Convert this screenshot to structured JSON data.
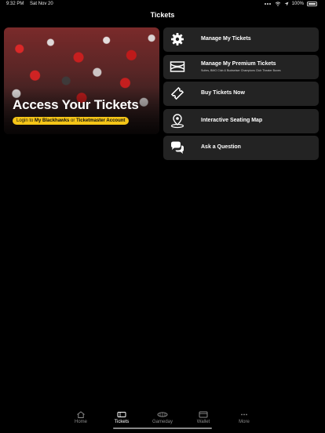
{
  "status_bar": {
    "time": "9:32 PM",
    "date": "Sat Nov 20",
    "battery": "100%"
  },
  "header": {
    "title": "Tickets"
  },
  "hero": {
    "title": "Access Your Tickets",
    "cta_prefix": "Login to ",
    "cta_brand1": "My Blackhawks",
    "cta_or": " or ",
    "cta_brand2": "Ticketmaster Account"
  },
  "menu": [
    {
      "label": "Manage My Tickets",
      "icon": "gear-icon"
    },
    {
      "label": "Manage My Premium Tickets",
      "sub": "Suites, BMO Club & Budweiser Champions Club Theater Boxes",
      "icon": "stadium-icon"
    },
    {
      "label": "Buy Tickets Now",
      "icon": "ticket-icon"
    },
    {
      "label": "Interactive Seating Map",
      "icon": "map-pin-icon"
    },
    {
      "label": "Ask a Question",
      "icon": "chat-bubbles-icon"
    }
  ],
  "tabs": [
    {
      "label": "Home",
      "icon": "home-icon"
    },
    {
      "label": "Tickets",
      "icon": "tickets-icon",
      "active": true
    },
    {
      "label": "Gameday",
      "icon": "gameday-icon"
    },
    {
      "label": "Wallet",
      "icon": "wallet-icon"
    },
    {
      "label": "More",
      "icon": "more-icon"
    }
  ],
  "colors": {
    "background": "#000000",
    "card": "#232323",
    "accent": "#f5c518",
    "tab_inactive": "#8a8a8a"
  }
}
